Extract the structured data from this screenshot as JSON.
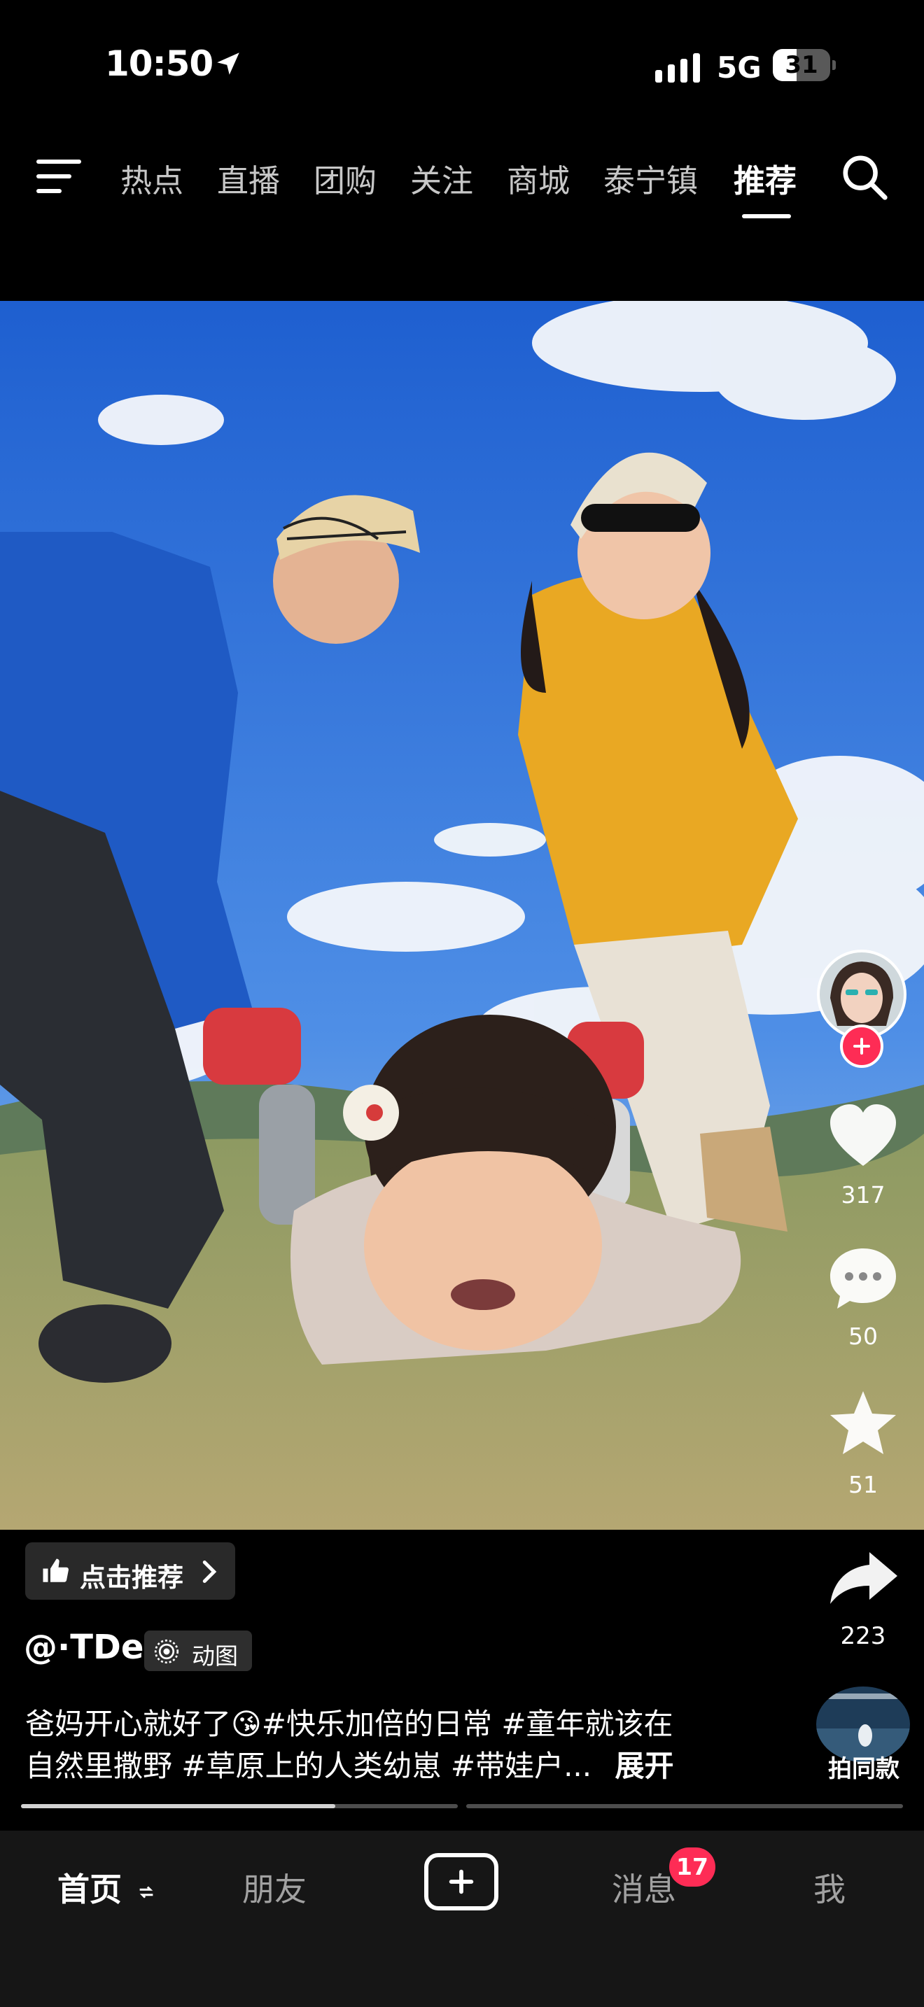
{
  "status_bar": {
    "time": "10:50",
    "network": "5G",
    "battery": "31"
  },
  "top_nav": {
    "tabs": [
      {
        "label": "热点"
      },
      {
        "label": "直播"
      },
      {
        "label": "团购"
      },
      {
        "label": "关注"
      },
      {
        "label": "商城"
      },
      {
        "label": "泰宁镇"
      },
      {
        "label": "推荐",
        "active": true
      }
    ]
  },
  "rail": {
    "likes": "317",
    "comments": "50",
    "favorites": "51",
    "shares": "223"
  },
  "post": {
    "recommend_label": "点击推荐",
    "author": "@·TDe",
    "media_tag": "动图",
    "description_line1": "爸妈开心就好了😘#快乐加倍的日常 #童年就该在",
    "description_line2": "自然里撒野 #草原上的人类幼崽 #带娃户...",
    "expand_label": "展开",
    "same_style_label": "拍同款"
  },
  "progress": {
    "segments": 2,
    "current_fraction": 0.72
  },
  "bottom_tabs": {
    "home": "首页",
    "friends": "朋友",
    "messages": "消息",
    "messages_badge": "17",
    "me": "我"
  },
  "colors": {
    "accent": "#fe2c55",
    "sky": "#2f6fd6",
    "background": "#000000"
  }
}
